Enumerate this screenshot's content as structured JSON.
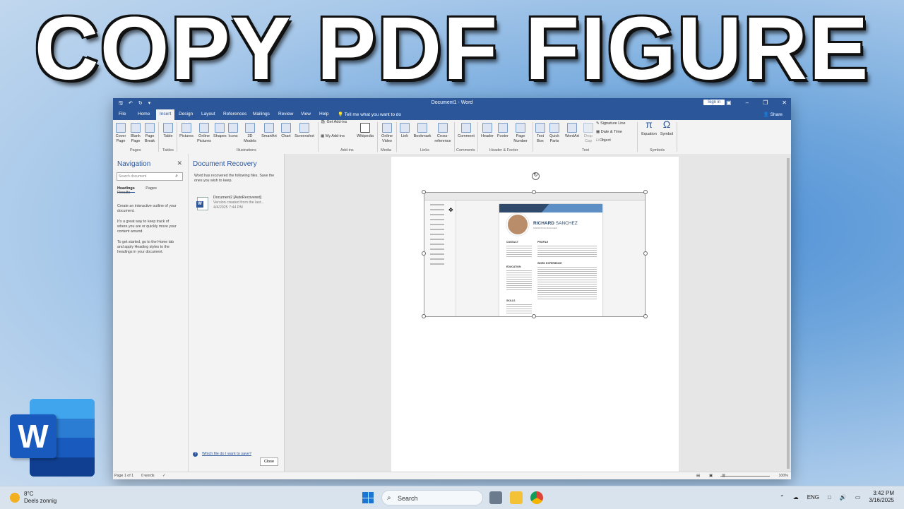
{
  "overlay": {
    "headline": "COPY PDF FIGURE"
  },
  "word": {
    "doc_title": "Document1 - Word",
    "sign_in": "Sign in",
    "share": "Share",
    "tell_me": "Tell me what you want to do",
    "tabs": [
      "File",
      "Home",
      "Insert",
      "Design",
      "Layout",
      "References",
      "Mailings",
      "Review",
      "View",
      "Help"
    ],
    "active_tab": "Insert",
    "ribbon": {
      "pages": {
        "group": "Pages",
        "items": [
          "Cover Page",
          "Blank Page",
          "Page Break"
        ]
      },
      "tables": {
        "group": "Tables",
        "items": [
          "Table"
        ]
      },
      "illustrations": {
        "group": "Illustrations",
        "items": [
          "Pictures",
          "Online Pictures",
          "Shapes",
          "Icons",
          "3D Models",
          "SmartArt",
          "Chart",
          "Screenshot"
        ]
      },
      "addins": {
        "group": "Add-ins",
        "items": [
          "Get Add-ins",
          "My Add-ins",
          "Wikipedia"
        ]
      },
      "media": {
        "group": "Media",
        "items": [
          "Online Video"
        ]
      },
      "links": {
        "group": "Links",
        "items": [
          "Link",
          "Bookmark",
          "Cross-reference"
        ]
      },
      "comments": {
        "group": "Comments",
        "items": [
          "Comment"
        ]
      },
      "header_footer": {
        "group": "Header & Footer",
        "items": [
          "Header",
          "Footer",
          "Page Number"
        ]
      },
      "text": {
        "group": "Text",
        "items": [
          "Text Box",
          "Quick Parts",
          "WordArt",
          "Drop Cap",
          "Signature Line",
          "Date & Time",
          "Object"
        ]
      },
      "symbols": {
        "group": "Symbols",
        "items": [
          "Equation",
          "Symbol"
        ]
      }
    },
    "navigation": {
      "title": "Navigation",
      "search_placeholder": "Search document",
      "tabs": [
        "Headings",
        "Pages",
        "Results"
      ],
      "text": [
        "Create an interactive outline of your document.",
        "It's a great way to keep track of where you are or quickly move your content around.",
        "To get started, go to the Home tab and apply Heading styles to the headings in your document."
      ]
    },
    "recovery": {
      "title": "Document Recovery",
      "intro": "Word has recovered the following files. Save the ones you wish to keep.",
      "file_name": "Document2 [AutoRecovered]",
      "file_desc": "Version created from the last...",
      "file_date": "4/4/2025 7:44 PM",
      "help_link": "Which file do I want to save?",
      "close": "Close"
    },
    "resume": {
      "name_first": "RICHARD",
      "name_last": "SANCHEZ",
      "role": "MARKETING MANAGER",
      "contact": "CONTACT",
      "profile": "PROFILE",
      "education": "EDUCATION",
      "work": "WORK EXPERIENCE",
      "skills": "SKILLS"
    },
    "status": {
      "page": "Page 1 of 1",
      "words": "0 words",
      "zoom": "100%"
    }
  },
  "taskbar": {
    "temp": "8°C",
    "weather": "Deels zonnig",
    "search": "Search",
    "lang": "ENG",
    "time": "3:42 PM",
    "date": "3/16/2025"
  },
  "colors": {
    "word_blue": "#2b579a",
    "accent": "#185abd"
  }
}
